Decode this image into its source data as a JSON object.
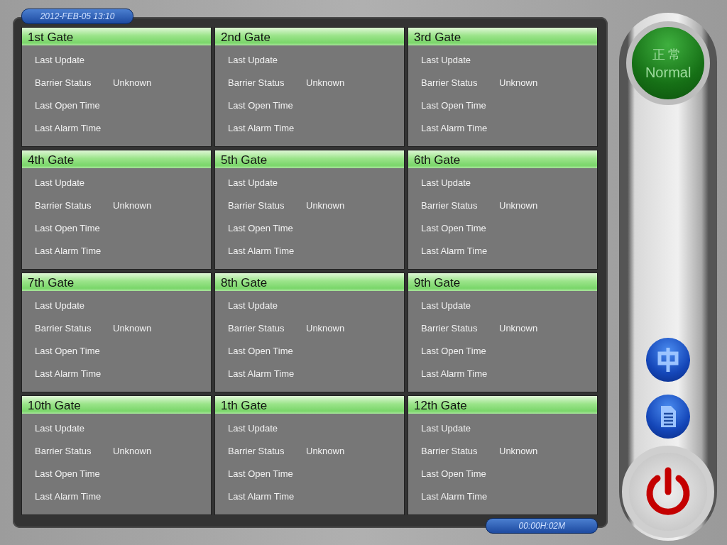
{
  "clock": "2012-FEB-05 13:10",
  "uptime": "00:00H:02M",
  "status_button": {
    "cjk": "正常",
    "label": "Normal"
  },
  "gates": [
    {
      "title": "1st Gate",
      "rows": [
        {
          "label": "Last Update"
        },
        {
          "label": "Barrier Status",
          "value": "Unknown"
        },
        {
          "label": "Last Open Time"
        },
        {
          "label": "Last Alarm Time"
        }
      ]
    },
    {
      "title": "2nd Gate",
      "rows": [
        {
          "label": "Last Update"
        },
        {
          "label": "Barrier Status",
          "value": "Unknown"
        },
        {
          "label": "Last Open Time"
        },
        {
          "label": "Last Alarm Time"
        }
      ]
    },
    {
      "title": "3rd Gate",
      "rows": [
        {
          "label": "Last Update"
        },
        {
          "label": "Barrier Status",
          "value": "Unknown"
        },
        {
          "label": "Last Open Time"
        },
        {
          "label": "Last Alarm Time"
        }
      ]
    },
    {
      "title": "4th Gate",
      "rows": [
        {
          "label": "Last Update"
        },
        {
          "label": "Barrier Status",
          "value": "Unknown"
        },
        {
          "label": "Last Open Time"
        },
        {
          "label": "Last Alarm Time"
        }
      ]
    },
    {
      "title": "5th Gate",
      "rows": [
        {
          "label": "Last Update"
        },
        {
          "label": "Barrier Status",
          "value": "Unknown"
        },
        {
          "label": "Last Open Time"
        },
        {
          "label": "Last Alarm Time"
        }
      ]
    },
    {
      "title": "6th Gate",
      "rows": [
        {
          "label": "Last Update"
        },
        {
          "label": "Barrier Status",
          "value": "Unknown"
        },
        {
          "label": "Last Open Time"
        },
        {
          "label": "Last Alarm Time"
        }
      ]
    },
    {
      "title": "7th Gate",
      "rows": [
        {
          "label": "Last Update"
        },
        {
          "label": "Barrier Status",
          "value": "Unknown"
        },
        {
          "label": "Last Open Time"
        },
        {
          "label": "Last Alarm Time"
        }
      ]
    },
    {
      "title": "8th Gate",
      "rows": [
        {
          "label": "Last Update"
        },
        {
          "label": "Barrier Status",
          "value": "Unknown"
        },
        {
          "label": "Last Open Time"
        },
        {
          "label": "Last Alarm Time"
        }
      ]
    },
    {
      "title": "9th Gate",
      "rows": [
        {
          "label": "Last Update"
        },
        {
          "label": "Barrier Status",
          "value": "Unknown"
        },
        {
          "label": "Last Open Time"
        },
        {
          "label": "Last Alarm Time"
        }
      ]
    },
    {
      "title": "10th Gate",
      "rows": [
        {
          "label": "Last Update"
        },
        {
          "label": "Barrier Status",
          "value": "Unknown"
        },
        {
          "label": "Last Open Time"
        },
        {
          "label": "Last Alarm Time"
        }
      ]
    },
    {
      "title": "1th Gate",
      "rows": [
        {
          "label": "Last Update"
        },
        {
          "label": "Barrier Status",
          "value": "Unknown"
        },
        {
          "label": "Last Open Time"
        },
        {
          "label": "Last Alarm Time"
        }
      ]
    },
    {
      "title": "12th Gate",
      "rows": [
        {
          "label": "Last Update"
        },
        {
          "label": "Barrier Status",
          "value": "Unknown"
        },
        {
          "label": "Last Open Time"
        },
        {
          "label": "Last Alarm Time"
        }
      ]
    }
  ]
}
